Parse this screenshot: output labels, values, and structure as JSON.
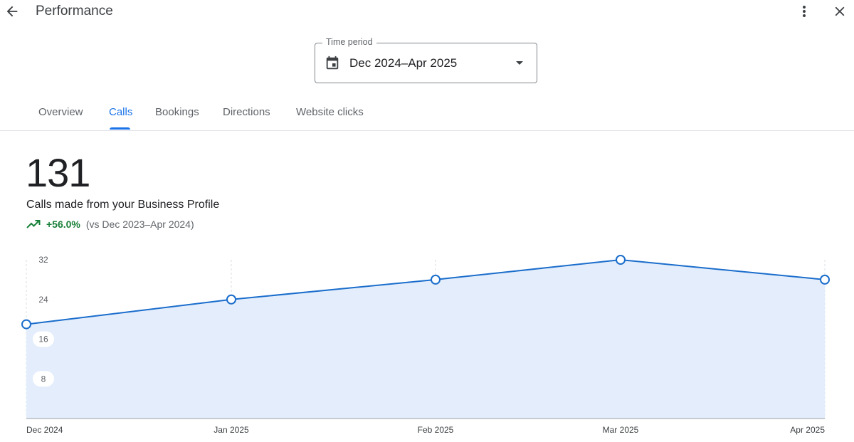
{
  "header": {
    "title": "Performance",
    "back_icon": "arrow-back-icon",
    "more_icon": "more-vert-icon",
    "close_icon": "close-icon"
  },
  "time_period": {
    "label": "Time period",
    "value": "Dec 2024–Apr 2025",
    "icon": "calendar-icon"
  },
  "tabs": [
    {
      "label": "Overview",
      "active": false
    },
    {
      "label": "Calls",
      "active": true
    },
    {
      "label": "Bookings",
      "active": false
    },
    {
      "label": "Directions",
      "active": false
    },
    {
      "label": "Website clicks",
      "active": false
    }
  ],
  "metric": {
    "value": "131",
    "label": "Calls made from your Business Profile",
    "change": "+56.0%",
    "comparison": "(vs Dec 2023–Apr 2024)"
  },
  "colors": {
    "accent": "#1a73e8",
    "line": "#1a6dcc",
    "area": "#e3edfb",
    "positive": "#188038"
  },
  "chart_data": {
    "type": "area",
    "categories": [
      "Dec 2024",
      "Jan 2025",
      "Feb 2025",
      "Mar 2025",
      "Apr 2025"
    ],
    "values": [
      19,
      24,
      28,
      32,
      28
    ],
    "yticks": [
      "8",
      "16",
      "24",
      "32"
    ],
    "ylim": [
      0,
      32
    ],
    "grid": "vertical dashed",
    "legend": "none"
  }
}
